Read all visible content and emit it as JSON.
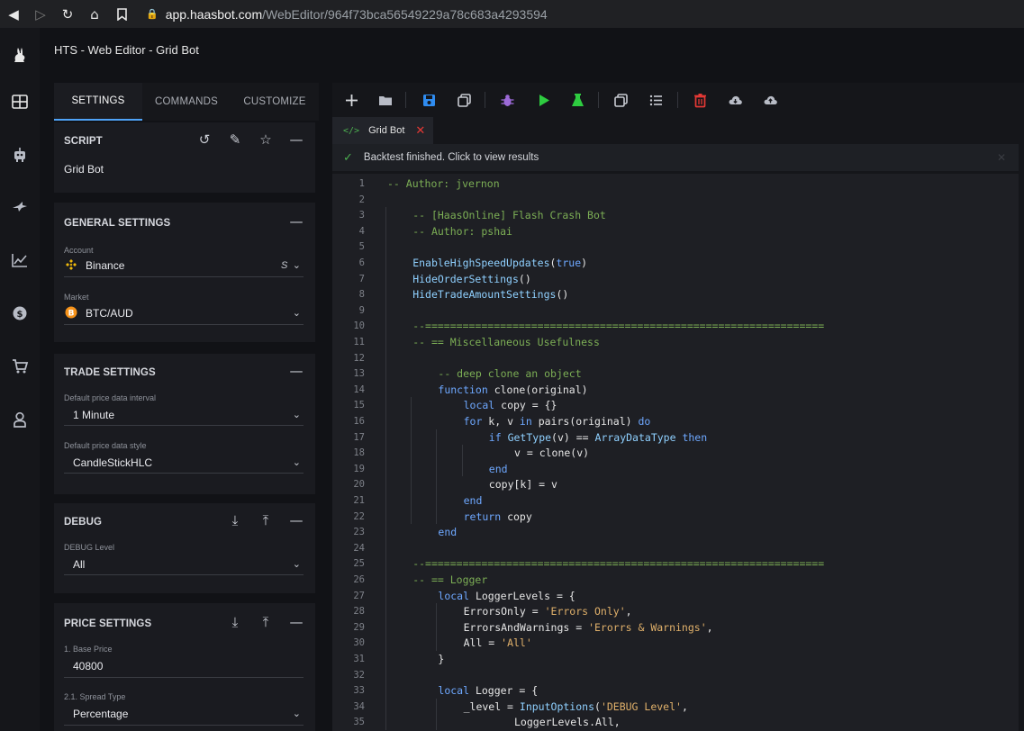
{
  "browser": {
    "url_host": "app.haasbot.com",
    "url_path": "/WebEditor/964f73bca56549229a78c683a4293594"
  },
  "app": {
    "title": "HTS - Web Editor - Grid Bot"
  },
  "tabs": [
    "SETTINGS",
    "COMMANDS",
    "CUSTOMIZE"
  ],
  "script": {
    "header": "SCRIPT",
    "name": "Grid Bot"
  },
  "general": {
    "header": "GENERAL SETTINGS",
    "account_label": "Account",
    "account_value": "Binance",
    "account_suffix": "S",
    "market_label": "Market",
    "market_value": "BTC/AUD"
  },
  "trade": {
    "header": "TRADE SETTINGS",
    "interval_label": "Default price data interval",
    "interval_value": "1 Minute",
    "style_label": "Default price data style",
    "style_value": "CandleStickHLC"
  },
  "debug": {
    "header": "DEBUG",
    "level_label": "DEBUG Level",
    "level_value": "All"
  },
  "price": {
    "header": "PRICE SETTINGS",
    "base_label": "1. Base Price",
    "base_value": "40800",
    "spread_label": "2.1. Spread Type",
    "spread_value": "Percentage"
  },
  "editor": {
    "file_tab": "Grid Bot",
    "notice": "Backtest finished. Click to view results",
    "code_lines": [
      {
        "n": "1",
        "indent": 0,
        "parts": [
          [
            "c",
            "-- Author: jvernon"
          ]
        ]
      },
      {
        "n": "2",
        "indent": 0,
        "parts": []
      },
      {
        "n": "3",
        "indent": 1,
        "parts": [
          [
            "c",
            "-- [HaasOnline] Flash Crash Bot"
          ]
        ]
      },
      {
        "n": "4",
        "indent": 1,
        "parts": [
          [
            "c",
            "-- Author: pshai"
          ]
        ]
      },
      {
        "n": "5",
        "indent": 1,
        "parts": []
      },
      {
        "n": "6",
        "indent": 1,
        "parts": [
          [
            "f",
            "EnableHighSpeedUpdates"
          ],
          [
            "p",
            "("
          ],
          [
            "k",
            "true"
          ],
          [
            "p",
            ")"
          ]
        ]
      },
      {
        "n": "7",
        "indent": 1,
        "parts": [
          [
            "f",
            "HideOrderSettings"
          ],
          [
            "p",
            "()"
          ]
        ]
      },
      {
        "n": "8",
        "indent": 1,
        "parts": [
          [
            "f",
            "HideTradeAmountSettings"
          ],
          [
            "p",
            "()"
          ]
        ]
      },
      {
        "n": "9",
        "indent": 1,
        "parts": []
      },
      {
        "n": "10",
        "indent": 1,
        "parts": [
          [
            "c",
            "--================================================================"
          ]
        ]
      },
      {
        "n": "11",
        "indent": 1,
        "parts": [
          [
            "c",
            "-- == Miscellaneous Usefulness"
          ]
        ]
      },
      {
        "n": "12",
        "indent": 1,
        "parts": []
      },
      {
        "n": "13",
        "indent": 2,
        "parts": [
          [
            "c",
            "-- deep clone an object"
          ]
        ]
      },
      {
        "n": "14",
        "indent": 2,
        "parts": [
          [
            "k",
            "function "
          ],
          [
            "p",
            "clone(original)"
          ]
        ]
      },
      {
        "n": "15",
        "indent": 3,
        "parts": [
          [
            "k",
            "local "
          ],
          [
            "p",
            "copy = {}"
          ]
        ]
      },
      {
        "n": "16",
        "indent": 3,
        "parts": [
          [
            "k",
            "for "
          ],
          [
            "p",
            "k, v "
          ],
          [
            "k",
            "in "
          ],
          [
            "p",
            "pairs(original) "
          ],
          [
            "k",
            "do"
          ]
        ]
      },
      {
        "n": "17",
        "indent": 4,
        "parts": [
          [
            "k",
            "if "
          ],
          [
            "f",
            "GetType"
          ],
          [
            "p",
            "(v) == "
          ],
          [
            "f",
            "ArrayDataType "
          ],
          [
            "k",
            "then"
          ]
        ]
      },
      {
        "n": "18",
        "indent": 5,
        "parts": [
          [
            "p",
            "v = clone(v)"
          ]
        ]
      },
      {
        "n": "19",
        "indent": 4,
        "parts": [
          [
            "k",
            "end"
          ]
        ]
      },
      {
        "n": "20",
        "indent": 4,
        "parts": [
          [
            "p",
            "copy[k] = v"
          ]
        ]
      },
      {
        "n": "21",
        "indent": 3,
        "parts": [
          [
            "k",
            "end"
          ]
        ]
      },
      {
        "n": "22",
        "indent": 3,
        "parts": [
          [
            "k",
            "return "
          ],
          [
            "p",
            "copy"
          ]
        ]
      },
      {
        "n": "23",
        "indent": 2,
        "parts": [
          [
            "k",
            "end"
          ]
        ]
      },
      {
        "n": "24",
        "indent": 1,
        "parts": []
      },
      {
        "n": "25",
        "indent": 1,
        "parts": [
          [
            "c",
            "--================================================================"
          ]
        ]
      },
      {
        "n": "26",
        "indent": 1,
        "parts": [
          [
            "c",
            "-- == Logger"
          ]
        ]
      },
      {
        "n": "27",
        "indent": 2,
        "parts": [
          [
            "k",
            "local "
          ],
          [
            "p",
            "LoggerLevels = {"
          ]
        ]
      },
      {
        "n": "28",
        "indent": 3,
        "parts": [
          [
            "p",
            "ErrorsOnly = "
          ],
          [
            "s",
            "'Errors Only'"
          ],
          [
            "p",
            ","
          ]
        ]
      },
      {
        "n": "29",
        "indent": 3,
        "parts": [
          [
            "p",
            "ErrorsAndWarnings = "
          ],
          [
            "s",
            "'Erorrs & Warnings'"
          ],
          [
            "p",
            ","
          ]
        ]
      },
      {
        "n": "30",
        "indent": 3,
        "parts": [
          [
            "p",
            "All = "
          ],
          [
            "s",
            "'All'"
          ]
        ]
      },
      {
        "n": "31",
        "indent": 2,
        "parts": [
          [
            "p",
            "}"
          ]
        ]
      },
      {
        "n": "32",
        "indent": 2,
        "parts": []
      },
      {
        "n": "33",
        "indent": 2,
        "parts": [
          [
            "k",
            "local "
          ],
          [
            "p",
            "Logger = {"
          ]
        ]
      },
      {
        "n": "34",
        "indent": 3,
        "parts": [
          [
            "p",
            "_level = "
          ],
          [
            "f",
            "InputOptions"
          ],
          [
            "p",
            "("
          ],
          [
            "s",
            "'DEBUG Level'"
          ],
          [
            "p",
            ","
          ]
        ]
      },
      {
        "n": "35",
        "indent": 5,
        "parts": [
          [
            "p",
            "LoggerLevels.All,"
          ]
        ]
      }
    ]
  },
  "colors": {
    "accent": "#4fa3f7",
    "comment": "#7cae55",
    "keyword": "#6ea8ff",
    "function": "#8fd0ff",
    "string": "#e0b06a",
    "plain": "#e6e6e6"
  }
}
